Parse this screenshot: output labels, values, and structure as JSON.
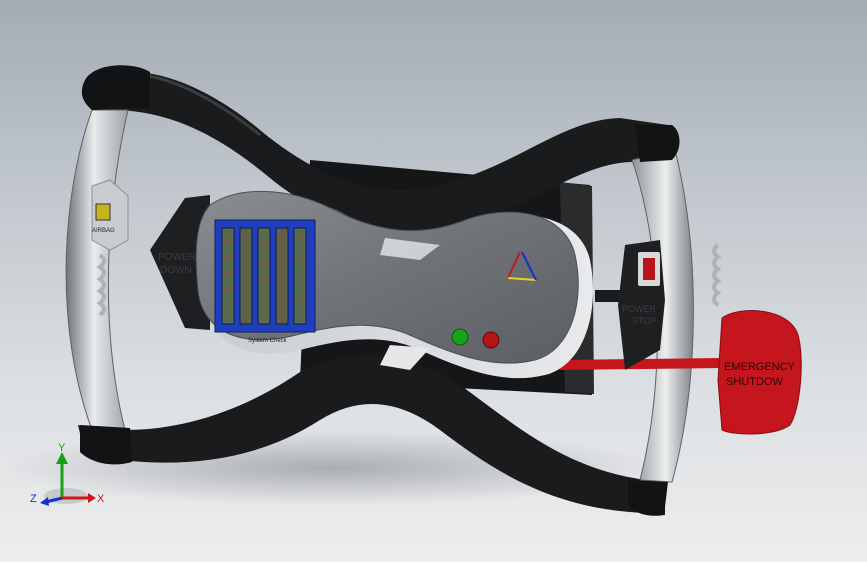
{
  "viewport": {
    "background_top": "#a3abb4",
    "background_bottom": "#ecedee"
  },
  "model": {
    "left_grip_button_label": "AIRBAG",
    "left_control_label_line1": "POWER",
    "left_control_label_line2": "DOWN",
    "center_module_label": "System Check",
    "right_control_label_line1": "POWER",
    "right_control_label_line2": "STOP",
    "emergency_label_line1": "EMERGENCY",
    "emergency_label_line2": "SHUTDOW",
    "status_lights": [
      {
        "name": "green",
        "color": "#17a31a"
      },
      {
        "name": "red",
        "color": "#b1141a"
      }
    ],
    "emergency_color": "#c4161c",
    "display_panel_color": "#1f3fbf",
    "display_bar_count": 5
  },
  "triad": {
    "x_label": "X",
    "y_label": "Y",
    "z_label": "Z",
    "x_color": "#d01818",
    "y_color": "#18a018",
    "z_color": "#1830c8"
  }
}
